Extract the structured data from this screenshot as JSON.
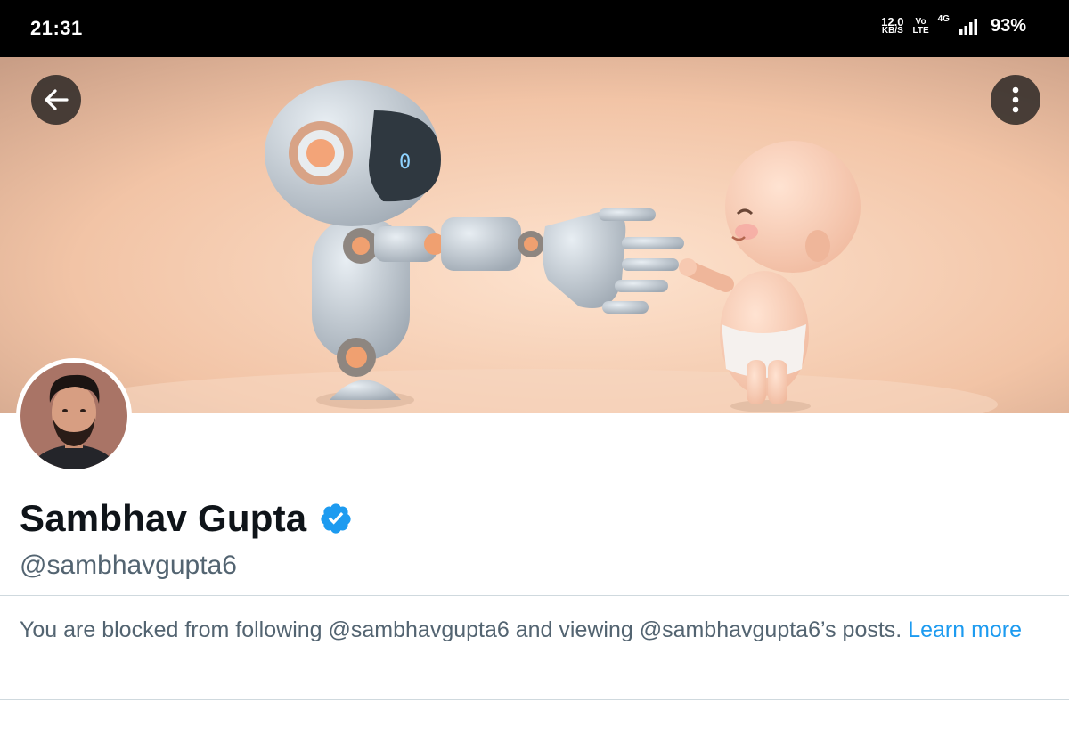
{
  "status_bar": {
    "time": "21:31",
    "speed_value": "12.0",
    "speed_unit": "KB/S",
    "volte_top": "Vo",
    "volte_bottom": "LTE",
    "network": "4G",
    "battery": "93%"
  },
  "header": {
    "back_icon": "arrow-left-icon",
    "more_icon": "vertical-dots-icon"
  },
  "profile": {
    "display_name": "Sambhav Gupta",
    "handle": "@sambhavgupta6",
    "verified": true,
    "verified_color": "#1d9bf0"
  },
  "notice": {
    "text": "You are blocked from following @sambhavgupta6 and viewing @sambhavgupta6’s posts.",
    "link": "Learn more",
    "link_color": "#1d9bf0"
  }
}
